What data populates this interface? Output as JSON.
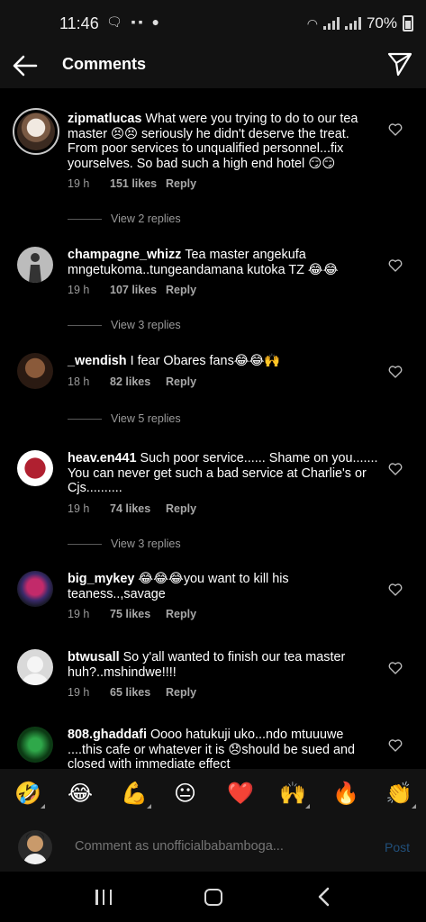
{
  "status": {
    "time": "11:46",
    "battery": "70%"
  },
  "header": {
    "title": "Comments"
  },
  "comments": [
    {
      "user": "zipmatlucas",
      "text": "What were you trying to do to our tea master 😣😣 seriously he didn't deserve the treat. From poor services to unqualified personnel...fix yourselves.  So bad such a high end hotel 😏😏",
      "time": "19 h",
      "likes": "151 likes",
      "reply": "Reply",
      "view_replies": "View 2 replies"
    },
    {
      "user": "champagne_whizz",
      "text": "Tea master angekufa mngetukoma..tungeandamana kutoka TZ 😂😂",
      "time": "19 h",
      "likes": "107 likes",
      "reply": "Reply",
      "view_replies": "View 3 replies"
    },
    {
      "user": "_wendish",
      "text": "I fear Obares fans😂😂🙌",
      "time": "18 h",
      "likes": "82 likes",
      "reply": "Reply",
      "view_replies": "View 5 replies"
    },
    {
      "user": "heav.en441",
      "text": "Such poor service...... Shame on you....... You can never get such a bad service at Charlie's or Cjs..........",
      "time": "19 h",
      "likes": "74 likes",
      "reply": "Reply",
      "view_replies": "View 3 replies"
    },
    {
      "user": "big_mykey",
      "text": "😂😂😂you want to kill his teaness..,savage",
      "time": "19 h",
      "likes": "75 likes",
      "reply": "Reply"
    },
    {
      "user": "btwusall",
      "text": "So y'all wanted to finish our tea master huh?..mshindwe!!!!",
      "time": "19 h",
      "likes": "65 likes",
      "reply": "Reply"
    },
    {
      "user": "808.ghaddafi",
      "text": "Oooo hatukuji uko...ndo mtuuuwe ....this cafe or whatever it is 😞should be sued and closed with immediate effect"
    }
  ],
  "emojis": [
    "🤣",
    "😂",
    "💪",
    "😐",
    "❤️",
    "🙌",
    "🔥",
    "👏"
  ],
  "input": {
    "placeholder": "Comment as unofficialbabamboga...",
    "post_label": "Post"
  },
  "colors": {
    "background": "#000000",
    "bar": "#121212",
    "meta": "#9a9a9a",
    "post_disabled": "#214f7a"
  }
}
